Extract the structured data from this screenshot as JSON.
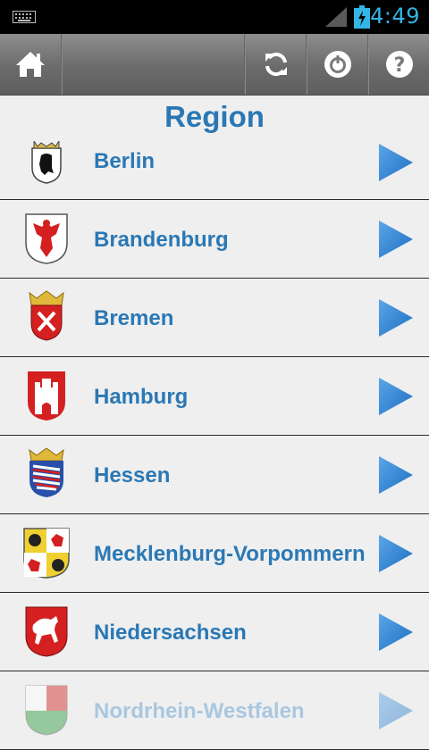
{
  "status_bar": {
    "time": "4:49",
    "accent": "#33b5e5"
  },
  "toolbar": {
    "home_icon": "home-icon",
    "refresh_icon": "refresh-icon",
    "power_icon": "power-icon",
    "help_icon": "help-icon"
  },
  "page": {
    "title": "Region"
  },
  "regions": [
    {
      "label": "Berlin",
      "icon": "berlin-crest-icon"
    },
    {
      "label": "Brandenburg",
      "icon": "brandenburg-crest-icon"
    },
    {
      "label": "Bremen",
      "icon": "bremen-crest-icon"
    },
    {
      "label": "Hamburg",
      "icon": "hamburg-crest-icon"
    },
    {
      "label": "Hessen",
      "icon": "hessen-crest-icon"
    },
    {
      "label": "Mecklenburg-Vorpommern",
      "icon": "mecklenburg-crest-icon"
    },
    {
      "label": "Niedersachsen",
      "icon": "niedersachsen-crest-icon"
    },
    {
      "label": "Nordrhein-Westfalen",
      "icon": "nrw-crest-icon"
    }
  ],
  "colors": {
    "label": "#2a78b5",
    "arrow": "#2f86d8",
    "background": "#efefef"
  }
}
